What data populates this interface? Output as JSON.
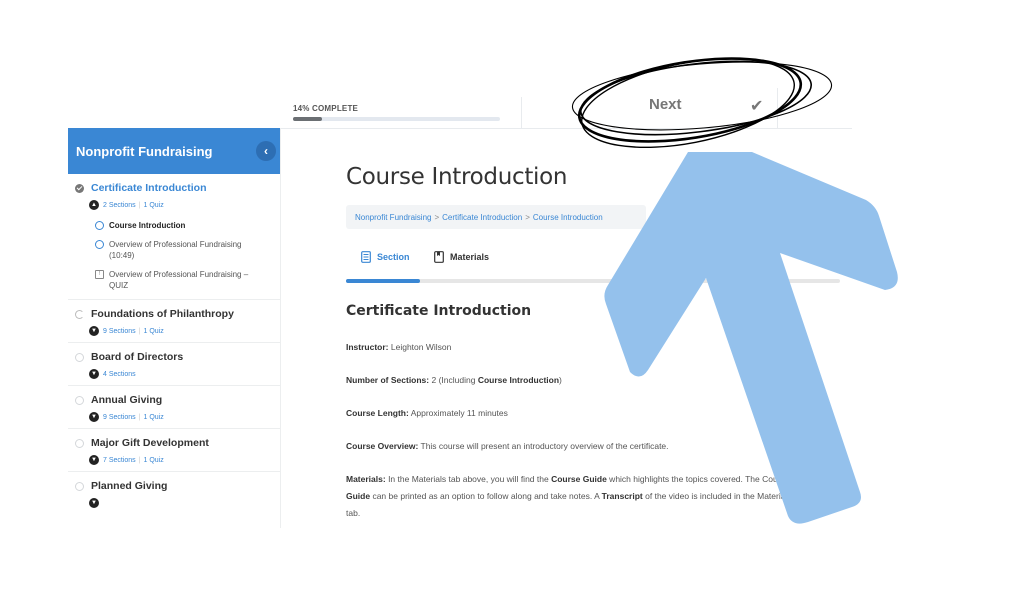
{
  "progress": {
    "label": "14% COMPLETE",
    "percent": 14
  },
  "nav": {
    "next_label": "Next",
    "next_icon": "checkmark-icon"
  },
  "sidebar": {
    "title": "Nonprofit Fundraising",
    "collapse_icon": "chevron-left-icon",
    "modules": [
      {
        "title": "Certificate Introduction",
        "status": "complete",
        "expanded": true,
        "active": true,
        "sections": "2 Sections",
        "quiz": "1 Quiz",
        "lessons": [
          {
            "title": "Course Introduction",
            "type": "video",
            "current": true
          },
          {
            "title": "Overview of Professional Fundraising (10:49)",
            "type": "video",
            "current": false
          },
          {
            "title": "Overview of Professional Fundraising – QUIZ",
            "type": "quiz",
            "current": false
          }
        ]
      },
      {
        "title": "Foundations of Philanthropy",
        "status": "in-progress",
        "sections": "9 Sections",
        "quiz": "1 Quiz"
      },
      {
        "title": "Board of Directors",
        "status": "not-started",
        "sections": "4 Sections",
        "quiz": ""
      },
      {
        "title": "Annual Giving",
        "status": "not-started",
        "sections": "9 Sections",
        "quiz": "1 Quiz"
      },
      {
        "title": "Major Gift Development",
        "status": "not-started",
        "sections": "7 Sections",
        "quiz": "1 Quiz"
      },
      {
        "title": "Planned Giving",
        "status": "not-started",
        "sections": "",
        "quiz": ""
      }
    ]
  },
  "main": {
    "title": "Course Introduction",
    "breadcrumb": [
      "Nonprofit Fundraising",
      "Certificate Introduction",
      "Course Introduction"
    ],
    "breadcrumb_sep": ">",
    "tabs": [
      {
        "label": "Section",
        "active": true,
        "icon": "document-icon"
      },
      {
        "label": "Materials",
        "active": false,
        "icon": "bookmark-icon"
      }
    ],
    "section_title": "Certificate Introduction",
    "instructor": {
      "label": "Instructor:",
      "value": "Leighton Wilson"
    },
    "num_sections": {
      "label": "Number of Sections:",
      "value": "2 (Including ",
      "bold": "Course Introduction",
      "end": ")"
    },
    "course_length": {
      "label": "Course Length:",
      "value": "Approximately 11 minutes"
    },
    "overview": {
      "label": "Course Overview:",
      "value": "This course will present an introductory overview of the certificate."
    },
    "materials": {
      "label": "Materials:",
      "t1": "In the Materials tab above, you will find the ",
      "b1": "Course Guide",
      "t2": " which highlights the topics covered. The Course",
      "b2": "Guide",
      "t3": " can be printed as an option to follow along and take notes. A ",
      "b3": "Transcript",
      "t4": " of the video is included in the Materials",
      "t5": "tab."
    }
  },
  "annotations": {
    "arrow_color": "#94c1ec",
    "circle_color": "#000000"
  },
  "colors": {
    "brand_blue": "#3a87d4"
  }
}
